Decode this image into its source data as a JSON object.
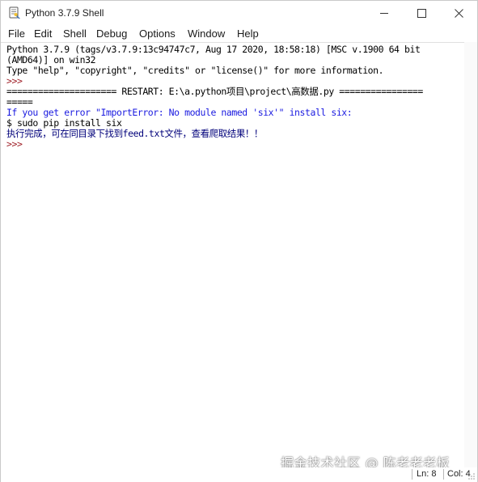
{
  "window": {
    "title": "Python 3.7.9 Shell",
    "controls": [
      "minimize",
      "maximize",
      "close"
    ]
  },
  "menu": {
    "items": [
      "File",
      "Edit",
      "Shell",
      "Debug",
      "Options",
      "Window",
      "Help"
    ]
  },
  "shell": {
    "banner_line1": "Python 3.7.9 (tags/v3.7.9:13c94747c7, Aug 17 2020, 18:58:18) [MSC v.1900 64 bit",
    "banner_line2": "(AMD64)] on win32",
    "banner_line3": "Type \"help\", \"copyright\", \"credits\" or \"license()\" for more information.",
    "prompt": ">>>",
    "restart_line": "===================== RESTART: E:\\a.python项目\\project\\高数据.py ================",
    "restart_cont": "=====",
    "error_line": "If you get error \"ImportError: No module named 'six'\" install six:",
    "install_line": "$ sudo pip install six",
    "done_line": "执行完成，可在同目录下找到feed.txt文件，查看爬取结果！！",
    "colors": {
      "stdout": "#000000",
      "prompt": "#a0222a",
      "stderr": "#1a1ae0",
      "output": "#00007a"
    }
  },
  "status": {
    "line": "Ln: 8",
    "col": "Col: 4"
  },
  "watermark": "掘金技术社区 @ 陈老老老板"
}
